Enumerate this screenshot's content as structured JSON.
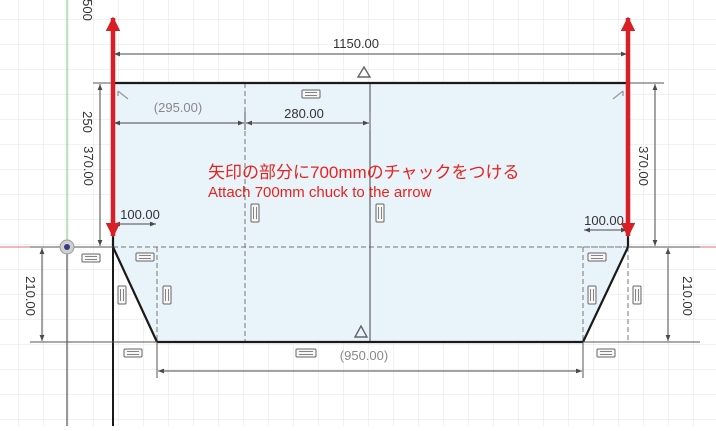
{
  "dimensions": {
    "top_total": "1150.00",
    "top_left_ref": "(295.00)",
    "top_mid": "280.00",
    "left_outer_partial": "500",
    "left_short": "250",
    "left_height": "370.00",
    "right_height": "370.00",
    "left_offset": "100.00",
    "right_offset": "100.00",
    "left_bottom_height": "210.00",
    "right_bottom_height": "210.00",
    "bottom_width_ref": "(950.00)"
  },
  "annotation": {
    "line_jp": "矢印の部分に700mmのチャックをつける",
    "line_en": "Attach 700mm chuck to the arrow"
  },
  "colors": {
    "annotation_text": "#e8231f",
    "arrow": "#d81f26",
    "sketch_fill": "#e9f3fa",
    "profile_line": "#1a1a1a",
    "dimension": "#4a4a4a",
    "grid": "#dadada",
    "axis_red": "#e07070",
    "axis_green": "#7ec87e"
  }
}
